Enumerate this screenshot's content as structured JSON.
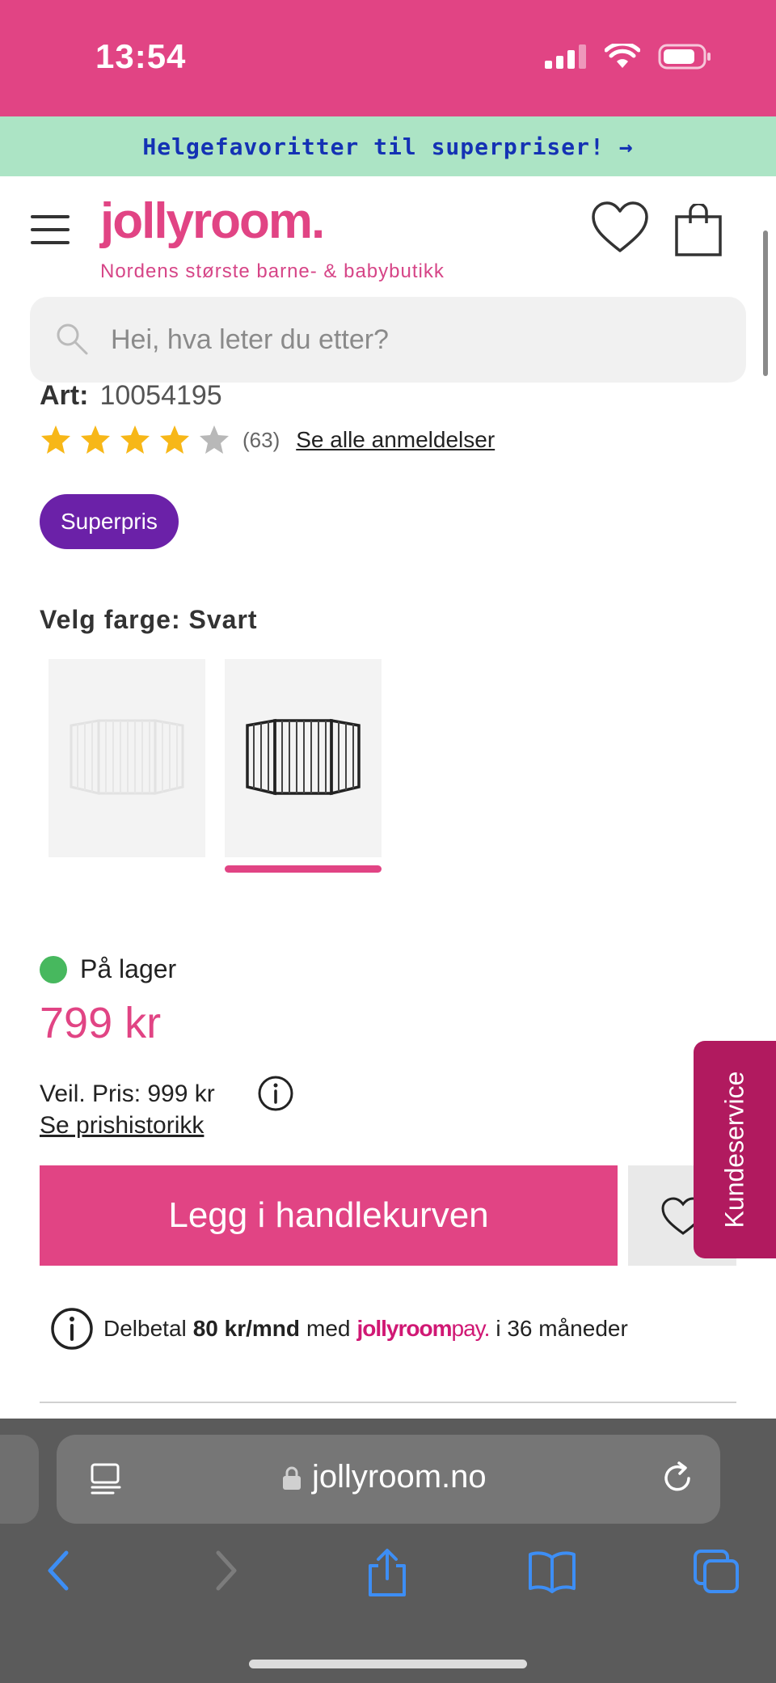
{
  "status_bar": {
    "time": "13:54",
    "icons": [
      "signal-icon",
      "wifi-icon",
      "battery-icon"
    ]
  },
  "promo": {
    "text": "Helgefavoritter til superpriser! →"
  },
  "header": {
    "logo": "jollyroom.",
    "tagline": "Nordens største barne- & babybutikk",
    "icons": [
      "menu-icon",
      "heart-icon",
      "shopping-bag-icon"
    ]
  },
  "search": {
    "placeholder": "Hei, hva leter du etter?"
  },
  "product": {
    "art_label": "Art:",
    "art_number": "10054195",
    "rating_count": "(63)",
    "reviews_link": "Se alle anmeldelser",
    "rating_value": 4,
    "rating_max": 5,
    "badge": "Superpris",
    "color_title": "Velg farge: Svart",
    "selected_color_index": 1,
    "stock_text": "På lager",
    "price": "799 kr",
    "rrp": "Veil. Pris: 999 kr",
    "price_history_link": "Se prishistorikk",
    "add_to_cart": "Legg i handlekurven"
  },
  "installment": {
    "prefix": "Delbetal",
    "amount": "80 kr/mnd",
    "middle": "med",
    "logo_main": "jollyroom",
    "logo_suffix": "pay.",
    "suffix": "i 36 måneder"
  },
  "customer_service": {
    "label": "Kundeservice"
  },
  "browser": {
    "url": "jollyroom.no"
  },
  "colors": {
    "brand": "#e14484",
    "promo_bg": "#ace4c5",
    "badge": "#6b21a8",
    "stock": "#47b85e",
    "cs_tab": "#b11a5f"
  }
}
